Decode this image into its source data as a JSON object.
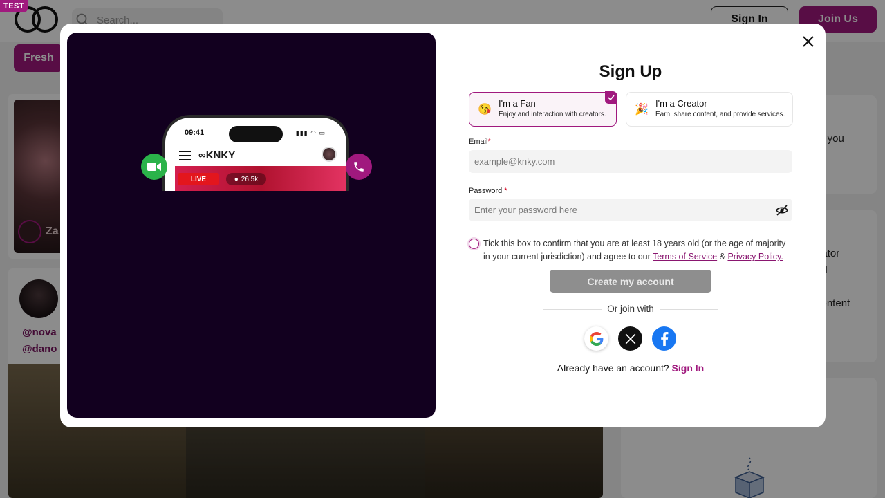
{
  "header": {
    "badge": "TEST",
    "search_placeholder": "Search...",
    "sign_in_label": "Sign In",
    "join_label": "Join Us"
  },
  "filters": {
    "active_chip": "Fresh"
  },
  "feed": {
    "card1_name": "Za",
    "handles": [
      "@nova",
      "@dano"
    ]
  },
  "right_panel": {
    "text1": "at you",
    "text2": "eator",
    "text3": "nd",
    "text4": "content"
  },
  "promo": {
    "time": "09:41",
    "brand": "KNKY",
    "live_label": "LIVE",
    "viewers": "26.5k"
  },
  "modal": {
    "title": "Sign Up",
    "roles": [
      {
        "title": "I'm a Fan",
        "description": "Enjoy and interaction with creators.",
        "selected": true
      },
      {
        "title": "I'm a Creator",
        "description": "Earn, share content, and provide services.",
        "selected": false
      }
    ],
    "email": {
      "label": "Email",
      "placeholder": "example@knky.com",
      "value": ""
    },
    "password": {
      "label": "Password",
      "placeholder": "Enter your password here",
      "value": ""
    },
    "required_mark": "*",
    "agree": {
      "text": "Tick this box to confirm that you are at least 18 years old (or the age of majority in your current jurisdiction) and agree to our",
      "terms": "Terms of Service",
      "amp": "&",
      "privacy": "Privacy Policy."
    },
    "create_label": "Create my account",
    "or_text": "Or join with",
    "social": [
      "google",
      "x",
      "facebook"
    ],
    "have_account": "Already have an account?",
    "sign_in_link": "Sign In"
  },
  "colors": {
    "accent": "#a0197e",
    "promo_bg": "#12001f",
    "disabled_button": "#8e8e8e",
    "facebook": "#1877f2"
  }
}
